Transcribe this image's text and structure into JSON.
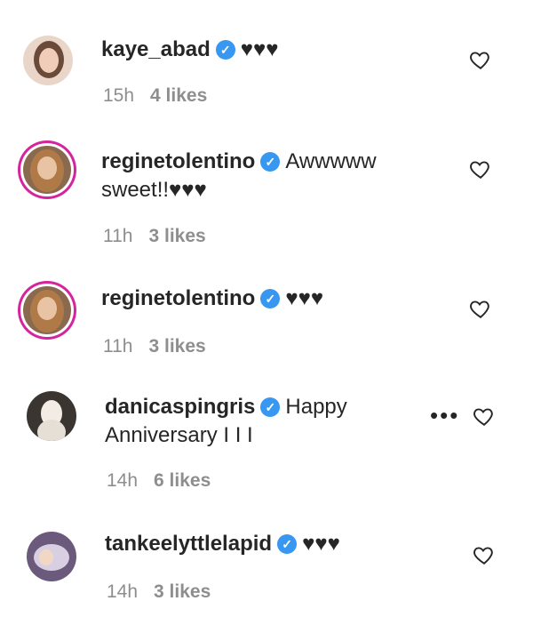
{
  "comments": [
    {
      "username": "kaye_abad",
      "text": "♥♥♥",
      "time": "15h",
      "likes": "4 likes"
    },
    {
      "username": "reginetolentino",
      "text": "Awwwww sweet!!♥♥♥",
      "time": "11h",
      "likes": "3 likes"
    },
    {
      "username": "reginetolentino",
      "text": "♥♥♥",
      "time": "11h",
      "likes": "3 likes"
    },
    {
      "username": "danicaspingris",
      "text": "Happy Anniversary I I I",
      "time": "14h",
      "likes": "6 likes"
    },
    {
      "username": "tankeelyttlelapid",
      "text": "♥♥♥",
      "time": "14h",
      "likes": "3 likes"
    }
  ],
  "more_label": "•••",
  "colors": {
    "verified": "#3897f0",
    "story_ring": "#d6249f",
    "meta": "#8e8e8e"
  }
}
